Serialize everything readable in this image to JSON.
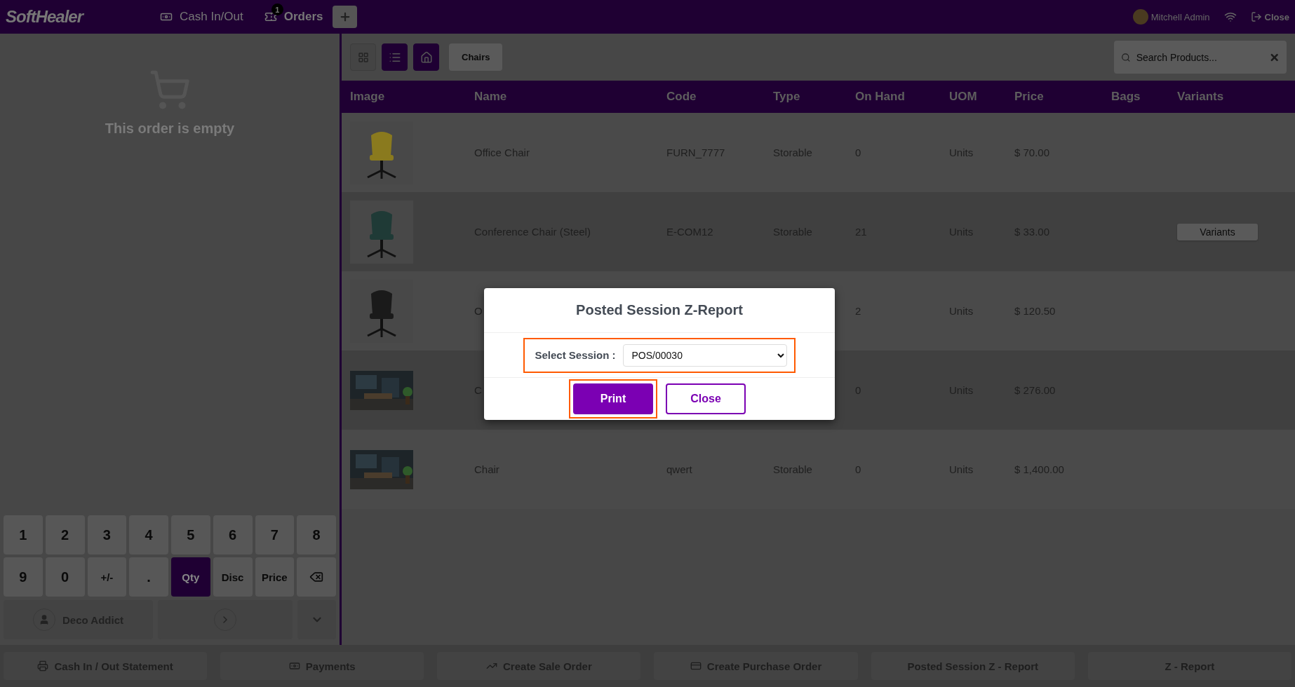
{
  "topbar": {
    "logo": "SoftHealer",
    "nav": [
      {
        "kind": "cash",
        "label": "Cash In/Out"
      },
      {
        "kind": "orders",
        "label": "Orders",
        "badge": "1"
      }
    ],
    "user": "Mitchell Admin",
    "close": "Close"
  },
  "toolbar": {
    "views": [
      {
        "kind": "grid",
        "selected": false
      },
      {
        "kind": "list",
        "selected": true
      },
      {
        "kind": "home",
        "selected": true
      }
    ],
    "category": "Chairs",
    "search": {
      "placeholder": "Search Products..."
    }
  },
  "order": {
    "empty_text": "This order is empty"
  },
  "numpad": {
    "keys": [
      {
        "label": "1",
        "selected": false
      },
      {
        "label": "2",
        "selected": false
      },
      {
        "label": "3",
        "selected": false
      },
      {
        "label": "4",
        "selected": false
      },
      {
        "label": "5",
        "selected": false
      },
      {
        "label": "6",
        "selected": false
      },
      {
        "label": "7",
        "selected": false
      },
      {
        "label": "8",
        "selected": false
      },
      {
        "label": "9",
        "selected": false
      },
      {
        "label": "0",
        "selected": false
      },
      {
        "label": "+/-",
        "selected": false
      },
      {
        "label": ".",
        "selected": false
      },
      {
        "label": "Qty",
        "selected": true
      },
      {
        "label": "Disc",
        "selected": false
      },
      {
        "label": "Price",
        "selected": false
      },
      {
        "kind": "backspace",
        "selected": false
      }
    ],
    "customer": "Deco Addict"
  },
  "table": {
    "columns": [
      "Image",
      "Name",
      "Code",
      "Type",
      "On Hand",
      "UOM",
      "Price",
      "Bags",
      "Variants"
    ],
    "rows": [
      {
        "name": "Office Chair",
        "code": "FURN_7777",
        "type": "Storable",
        "on_hand": "0",
        "uom": "Units",
        "price": "$ 70.00"
      },
      {
        "name": "Conference Chair (Steel)",
        "code": "E-COM12",
        "type": "Storable",
        "on_hand": "21",
        "uom": "Units",
        "price": "$ 33.00",
        "variants": "Variants"
      },
      {
        "name": "O",
        "on_hand": "2",
        "uom": "Units",
        "price": "$ 120.50"
      },
      {
        "name": "C",
        "on_hand": "0",
        "uom": "Units",
        "price": "$ 276.00"
      },
      {
        "name": "Chair",
        "code": "qwert",
        "type": "Storable",
        "on_hand": "0",
        "uom": "Units",
        "price": "$ 1,400.00"
      }
    ]
  },
  "bottom_buttons": [
    {
      "kind": "printer",
      "label": "Cash In / Out Statement"
    },
    {
      "kind": "money",
      "label": "Payments"
    },
    {
      "kind": "chart",
      "label": "Create Sale Order"
    },
    {
      "kind": "card",
      "label": "Create Purchase Order"
    },
    {
      "kind": "plain",
      "label": "Posted Session Z - Report"
    },
    {
      "kind": "plain",
      "label": "Z - Report"
    }
  ],
  "modal": {
    "title": "Posted Session Z-Report",
    "session_label": "Select Session :",
    "session_value": "POS/00030",
    "session_highlighted": true,
    "buttons": [
      {
        "kind": "primary",
        "label": "Print",
        "highlighted": true
      },
      {
        "kind": "secondary",
        "label": "Close",
        "highlighted": false
      }
    ]
  }
}
